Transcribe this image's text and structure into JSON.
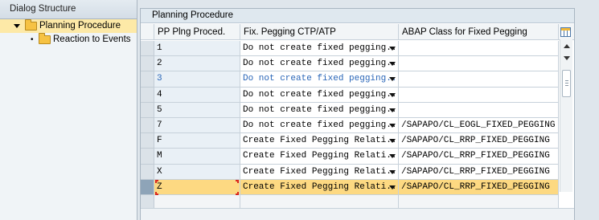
{
  "dialog_structure": {
    "title": "Dialog Structure",
    "items": [
      {
        "label": "Planning Procedure",
        "icon": "folder-open-icon",
        "selected": true
      },
      {
        "label": "Reaction to Events",
        "icon": "folder-icon",
        "selected": false
      }
    ]
  },
  "table": {
    "title": "Planning Procedure",
    "columns": [
      "PP Plng Proced.",
      "Fix. Pegging CTP/ATP",
      "ABAP Class for Fixed Pegging"
    ],
    "rows": [
      {
        "proc": "1",
        "pegging": "Do not create fixed pegging...",
        "abap_class": ""
      },
      {
        "proc": "2",
        "pegging": "Do not create fixed pegging...",
        "abap_class": ""
      },
      {
        "proc": "3",
        "pegging": "Do not create fixed pegging...",
        "abap_class": ""
      },
      {
        "proc": "4",
        "pegging": "Do not create fixed pegging...",
        "abap_class": ""
      },
      {
        "proc": "5",
        "pegging": "Do not create fixed pegging...",
        "abap_class": ""
      },
      {
        "proc": "7",
        "pegging": "Do not create fixed pegging...",
        "abap_class": "/SAPAPO/CL_EOGL_FIXED_PEGGING"
      },
      {
        "proc": "F",
        "pegging": "Create Fixed Pegging Relati...",
        "abap_class": "/SAPAPO/CL_RRP_FIXED_PEGGING"
      },
      {
        "proc": "M",
        "pegging": "Create Fixed Pegging Relati...",
        "abap_class": "/SAPAPO/CL_RRP_FIXED_PEGGING"
      },
      {
        "proc": "X",
        "pegging": "Create Fixed Pegging Relati...",
        "abap_class": "/SAPAPO/CL_RRP_FIXED_PEGGING"
      },
      {
        "proc": "Z",
        "pegging": "Create Fixed Pegging Relati...",
        "abap_class": "/SAPAPO/CL_RRP_FIXED_PEGGING"
      }
    ]
  },
  "colors": {
    "highlight_row": "#fdd982",
    "blue_text": "#2a66b8",
    "tree_selected": "#fde9a7"
  }
}
